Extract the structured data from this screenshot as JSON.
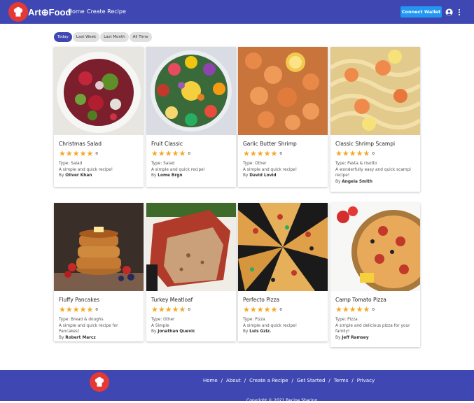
{
  "header": {
    "brand": "Art⊕Food",
    "nav": [
      "Home",
      "Create Recipe"
    ],
    "connect_label": "Connect Wallet"
  },
  "filters": [
    "Today",
    "Last Week",
    "Last Month",
    "All Time"
  ],
  "active_filter": "Today",
  "recipes": [
    {
      "title": "Christmas Salad",
      "rating": 5,
      "count": "0",
      "type": "Type: Salad",
      "desc": "A simple and quick recipe!",
      "by": "By",
      "author": "Oliver Khan"
    },
    {
      "title": "Fruit Classic",
      "rating": 5,
      "count": "0",
      "type": "Type: Salad",
      "desc": "A simple and quick recipe!",
      "by": "By",
      "author": "Lome Brgn"
    },
    {
      "title": "Garlic Butter Shrimp",
      "rating": 5,
      "count": "0",
      "type": "Type: Other",
      "desc": "A simple and quick recipe!",
      "by": "By",
      "author": "David Lovid"
    },
    {
      "title": "Classic Shrimp Scampi",
      "rating": 5,
      "count": "0",
      "type": "Type: Pasta & risotto",
      "desc": "A wonderfully easy and quick scampi recipe!",
      "by": "By",
      "author": "Angela Smith"
    },
    {
      "title": "Fluffy Pancakes",
      "rating": 5,
      "count": "0",
      "type": "Type: Bread & doughs",
      "desc": "A simple and quick recipe for Pancakes!",
      "by": "By",
      "author": "Robert Marcz"
    },
    {
      "title": "Turkey Meatloaf",
      "rating": 5,
      "count": "0",
      "type": "Type: Other",
      "desc": "A Simple",
      "by": "By",
      "author": "Jonathan Quevic"
    },
    {
      "title": "Perfecto Pizza",
      "rating": 5,
      "count": "0",
      "type": "Type: Pizza",
      "desc": "A simple and quick recipe!",
      "by": "By",
      "author": "Luis Gzlz."
    },
    {
      "title": "Camp Tomato Pizza",
      "rating": 5,
      "count": "0",
      "type": "Type: Pizza",
      "desc": "A simple and delicious pizza for your family!",
      "by": "By",
      "author": "Jeff Ramsey"
    }
  ],
  "footer": {
    "links": [
      "Home",
      "About",
      "Create a Recipe",
      "Get Started",
      "Terms",
      "Privacy"
    ],
    "copyright": "Copyright © 2021 Recipe Sharing"
  },
  "colors": {
    "primary": "#3f48b2",
    "accent": "#2196f3",
    "star": "#f5a623",
    "logo": "#e53935"
  },
  "icons": [
    "chef-hat-icon",
    "account-circle-icon",
    "more-vert-icon",
    "star-icon"
  ]
}
